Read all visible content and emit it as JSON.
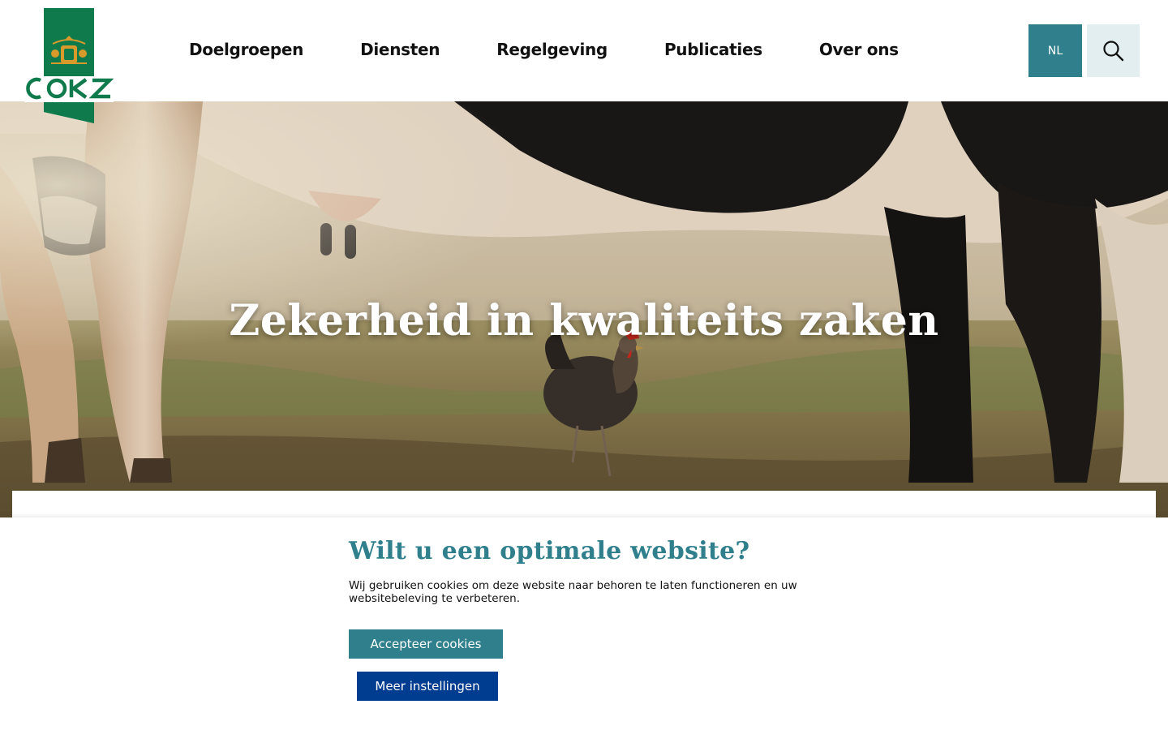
{
  "brand": {
    "name": "COKZ",
    "green": "#0f7a4c",
    "teal": "#2f7f8d",
    "navy": "#003c8f"
  },
  "nav": {
    "items": [
      {
        "label": "Doelgroepen"
      },
      {
        "label": "Diensten"
      },
      {
        "label": "Regelgeving"
      },
      {
        "label": "Publicaties"
      },
      {
        "label": "Over ons"
      }
    ]
  },
  "header": {
    "language": "NL",
    "search_icon": "search-icon"
  },
  "hero": {
    "title": "Zekerheid in kwaliteits zaken"
  },
  "cookie": {
    "title": "Wilt u een optimale website?",
    "text": "Wij gebruiken cookies om deze website naar behoren te laten functioneren en uw websitebeleving te verbeteren.",
    "accept_label": "Accepteer cookies",
    "more_label": "Meer instellingen"
  }
}
